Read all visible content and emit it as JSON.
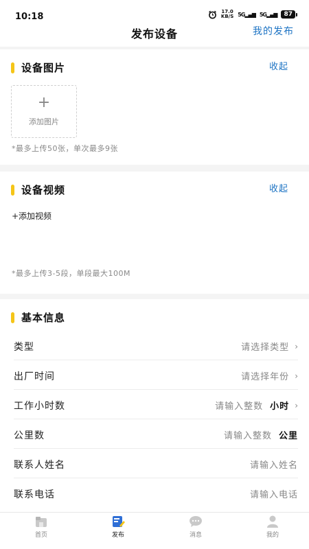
{
  "status_bar": {
    "time": "10:18",
    "speed_value": "17.0",
    "speed_unit": "KB/S",
    "signal_1": "5G",
    "signal_2": "5G",
    "battery": "87"
  },
  "nav": {
    "title": "发布设备",
    "right_link": "我的发布"
  },
  "photo_section": {
    "title": "设备图片",
    "collapse_label": "收起",
    "add_label": "添加图片",
    "add_icon": "plus-icon",
    "hint": "*最多上传50张，单次最多9张"
  },
  "video_section": {
    "title": "设备视频",
    "collapse_label": "收起",
    "add_label": "+添加视频",
    "hint": "*最多上传3-5段，单段最大100M"
  },
  "basic_section": {
    "title": "基本信息",
    "rows": [
      {
        "label": "类型",
        "placeholder": "请选择类型"
      },
      {
        "label": "出厂时间",
        "placeholder": "请选择年份"
      },
      {
        "label": "工作小时数",
        "placeholder": "请输入整数",
        "unit": "小时"
      },
      {
        "label": "公里数",
        "placeholder": "请输入整数",
        "unit": "公里"
      },
      {
        "label": "联系人姓名",
        "placeholder": "请输入姓名"
      },
      {
        "label": "联系电话",
        "placeholder": "请输入电话"
      }
    ]
  },
  "tab_bar": {
    "tabs": [
      {
        "label": "首页",
        "icon": "home-icon"
      },
      {
        "label": "发布",
        "icon": "publish-icon"
      },
      {
        "label": "消息",
        "icon": "message-icon"
      },
      {
        "label": "我的",
        "icon": "profile-icon"
      }
    ],
    "active_index": 1
  },
  "colors": {
    "accent": "#1e74c4",
    "section_bar": "#f5c518",
    "publish_tab_icon": "#2f6fd6"
  }
}
